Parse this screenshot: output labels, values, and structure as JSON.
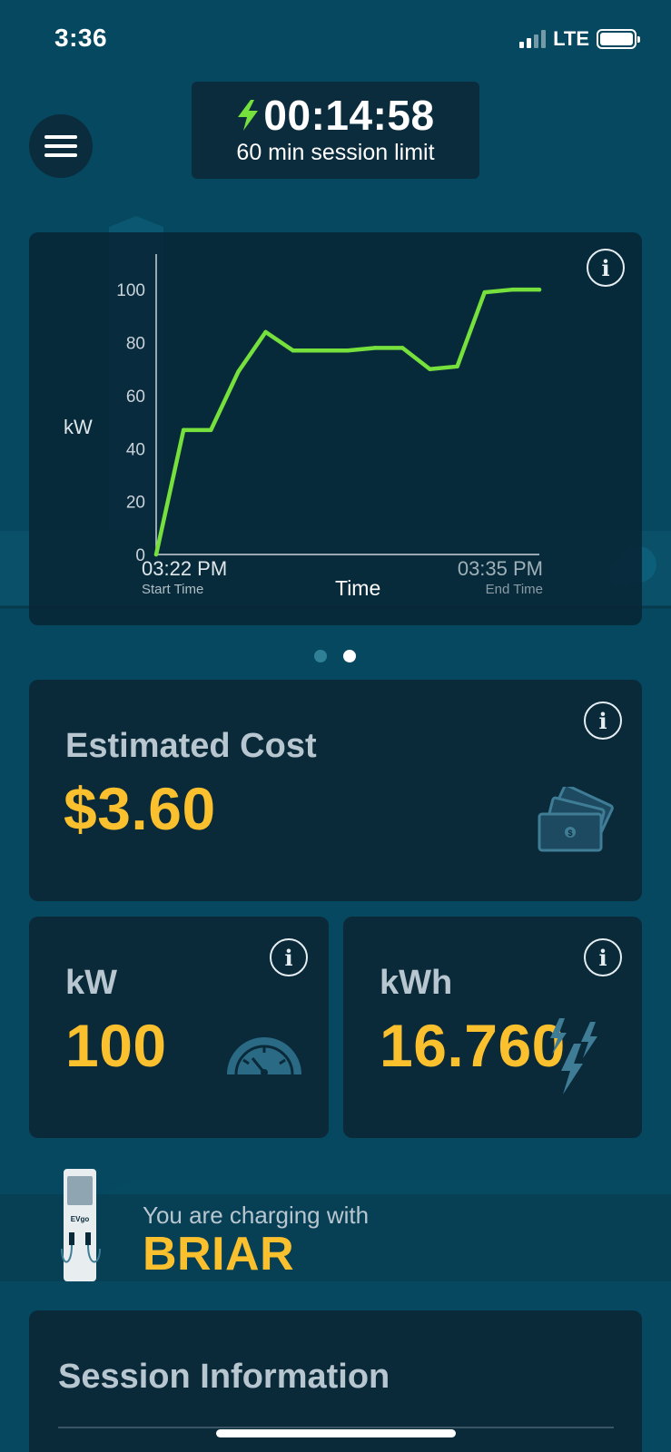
{
  "status_bar": {
    "time": "3:36",
    "network": "LTE"
  },
  "timer": {
    "elapsed": "00:14:58",
    "limit_text": "60 min session limit"
  },
  "chart_data": {
    "type": "line",
    "ylabel": "kW",
    "xlabel": "Time",
    "ylim": [
      0,
      110
    ],
    "yticks": [
      0,
      20,
      40,
      60,
      80,
      100
    ],
    "x_start_label": "03:22 PM",
    "x_start_caption": "Start Time",
    "x_end_label": "03:35 PM",
    "x_end_caption": "End Time",
    "series": [
      {
        "values": [
          0,
          47,
          47,
          69,
          84,
          77,
          77,
          77,
          78,
          78,
          70,
          71,
          99,
          100,
          100
        ]
      }
    ],
    "line_color": "#76e03c"
  },
  "pager": {
    "count": 2,
    "active": 1
  },
  "cost": {
    "label": "Estimated Cost",
    "value": "$3.60"
  },
  "power": {
    "label": "kW",
    "value": "100"
  },
  "energy": {
    "label": "kWh",
    "value": "16.760"
  },
  "charger": {
    "prefix": "You are charging with",
    "name": "BRIAR",
    "logo_text": "EVgo"
  },
  "session": {
    "title": "Session Information"
  },
  "colors": {
    "accent": "#fbc02d",
    "line": "#76e03c",
    "card": "#0a2a3a",
    "background": "#05485f"
  }
}
